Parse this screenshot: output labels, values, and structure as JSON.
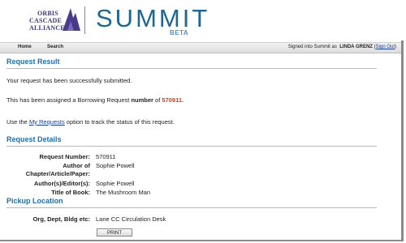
{
  "header": {
    "logo_line1": "ORBIS",
    "logo_line2": "CASCADE",
    "logo_line3": "ALLIANCE",
    "app_name": "SUMMIT",
    "app_badge": "BETA"
  },
  "nav": {
    "home": "Home",
    "search": "Search",
    "signed_in_prefix": "Signed into Summit as",
    "user_name": "LINDA GRENZ",
    "sign_out_open": "(",
    "sign_out": "Sign Out",
    "sign_out_close": ")"
  },
  "result": {
    "title": "Request Result",
    "success_msg": "Your request has been successfully submitted.",
    "assigned_prefix": "This has been assigned a Borrowing Request ",
    "assigned_bold": "number",
    "assigned_of": " of ",
    "request_number": "570911",
    "assigned_end": ".",
    "track_prefix": "Use the ",
    "my_requests_link": "My Requests",
    "track_suffix": " option to track the status of this request."
  },
  "details": {
    "title": "Request Details",
    "rows": [
      {
        "label": "Request Number:",
        "value": "570911"
      },
      {
        "label": "Author of",
        "value": "Sophie Powell"
      },
      {
        "label": "Chapter/Article/Paper:",
        "value": ""
      },
      {
        "label": "Author(s)/Editor(s):",
        "value": "Sophie Powell"
      },
      {
        "label": "Title of Book:",
        "value": "The Mushroom Man"
      }
    ]
  },
  "pickup": {
    "title": "Pickup Location",
    "label": "Org, Dept, Bldg etc:",
    "value": "Lane CC Circulation Desk",
    "print_label": "PRINT"
  },
  "colors": {
    "accent": "#1f6ea8",
    "request_number": "#c0451f",
    "link": "#1a3d8f"
  }
}
